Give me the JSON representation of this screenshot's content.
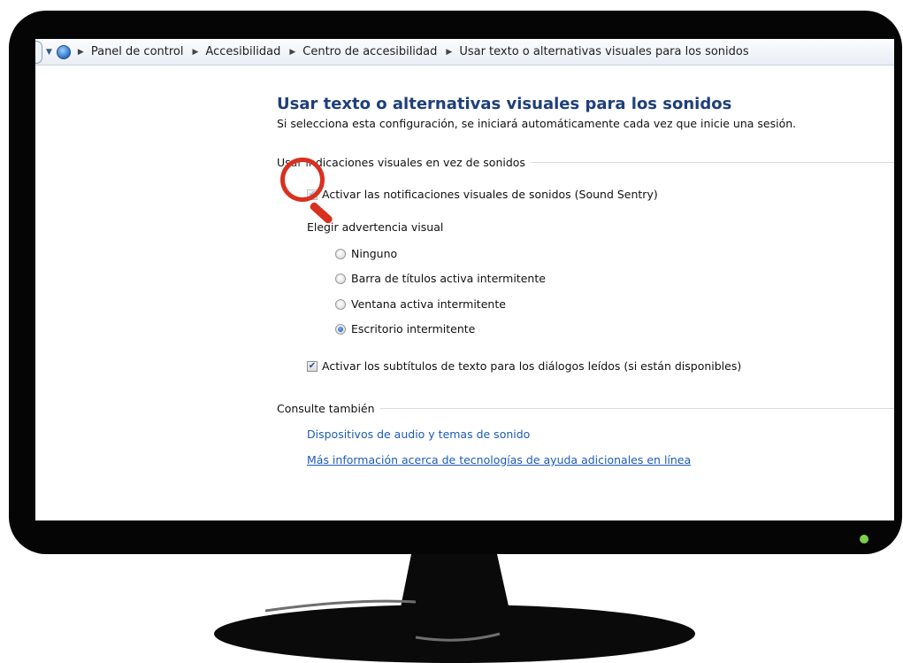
{
  "breadcrumb": {
    "items": [
      "Panel de control",
      "Accesibilidad",
      "Centro de accesibilidad",
      "Usar texto o alternativas visuales para los sonidos"
    ]
  },
  "page": {
    "title": "Usar texto o alternativas visuales para los sonidos",
    "subtitle": "Si selecciona esta configuración, se iniciará automáticamente cada vez que inicie una sesión."
  },
  "visual_section": {
    "heading": "Usar indicaciones visuales en vez de sonidos",
    "sound_sentry": {
      "label": "Activar las notificaciones visuales de sonidos (Sound Sentry)",
      "checked": true
    },
    "warning_heading": "Elegir advertencia visual",
    "options": [
      {
        "label": "Ninguno",
        "selected": false
      },
      {
        "label": "Barra de títulos activa intermitente",
        "selected": false
      },
      {
        "label": "Ventana activa intermitente",
        "selected": false
      },
      {
        "label": "Escritorio intermitente",
        "selected": true
      }
    ],
    "captions": {
      "label": "Activar los subtítulos de texto para los diálogos leídos (si están disponibles)",
      "checked": true
    }
  },
  "see_also": {
    "heading": "Consulte también",
    "links": [
      "Dispositivos de audio y temas de sonido",
      "Más información acerca de tecnologías de ayuda adicionales en línea"
    ]
  },
  "icons": {
    "nav": "dropdown-arrow-icon",
    "control_panel": "control-panel-icon",
    "separator": "chevron-right-icon",
    "highlight": "magnifier-icon",
    "power": "power-led-icon"
  },
  "colors": {
    "title": "#1e3f7a",
    "link": "#1c5bb8",
    "highlight": "#d9301f",
    "power_led": "#7ccf4a",
    "monitor": "#050505"
  }
}
